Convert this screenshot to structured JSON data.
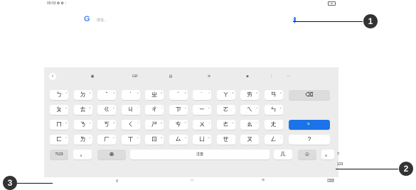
{
  "status": {
    "time": "09:03 ✿ ✿ ↑",
    "battery": "80"
  },
  "search": {
    "logo": "G",
    "placeholder": "搜尋..."
  },
  "toolbar": {
    "back": "‹",
    "items": [
      "▣",
      "GIF",
      "▤",
      "✲",
      "☻",
      "⋮",
      "⋯"
    ]
  },
  "rows": [
    [
      [
        "ㄅ",
        "1"
      ],
      [
        "ㄉ",
        "2"
      ],
      [
        "ˇ",
        "3"
      ],
      [
        "ˋ",
        "4"
      ],
      [
        "ㄓ",
        "5"
      ],
      [
        "ˊ",
        "6"
      ],
      [
        "˙",
        "7"
      ],
      [
        "ㄚ",
        "8"
      ],
      [
        "ㄞ",
        "9"
      ],
      [
        "ㄢ",
        "0"
      ]
    ],
    [
      [
        "ㄆ",
        "q"
      ],
      [
        "ㄊ",
        "w"
      ],
      [
        "ㄍ",
        "e"
      ],
      [
        "ㄐ",
        "r"
      ],
      [
        "ㄔ",
        "t"
      ],
      [
        "ㄗ",
        "y"
      ],
      [
        "ㄧ",
        "u"
      ],
      [
        "ㄛ",
        "i"
      ],
      [
        "ㄟ",
        "o"
      ],
      [
        "ㄣ",
        "p"
      ]
    ],
    [
      [
        "ㄇ",
        "a"
      ],
      [
        "ㄋ",
        "s"
      ],
      [
        "ㄎ",
        "d"
      ],
      [
        "ㄑ",
        "f"
      ],
      [
        "ㄕ",
        "g"
      ],
      [
        "ㄘ",
        "h"
      ],
      [
        "ㄨ",
        "j"
      ],
      [
        "ㄜ",
        "k"
      ],
      [
        "ㄠ",
        "l"
      ],
      [
        "ㄤ",
        ";"
      ]
    ],
    [
      [
        "ㄈ",
        "z"
      ],
      [
        "ㄌ",
        "x"
      ],
      [
        "ㄏ",
        "c"
      ],
      [
        "ㄒ",
        "v"
      ],
      [
        "ㄖ",
        "b"
      ],
      [
        "ㄙ",
        "n"
      ],
      [
        "ㄩ",
        "m"
      ],
      [
        "ㄝ",
        ","
      ],
      [
        "ㄡ",
        "."
      ],
      [
        "ㄥ",
        "/"
      ]
    ]
  ],
  "keys": {
    "delete": "⌫",
    "search": "🔍",
    "question": "?",
    "sym": "?123",
    "comma": "，",
    "globe": "⊕",
    "space": "注音",
    "er": "ㄦ",
    "emoji": "☺",
    "period": "。",
    "sym2": "?123"
  },
  "nav": {
    "back": "∨",
    "home": "○",
    "recents": "≡",
    "kbd": "⌨"
  },
  "callouts": {
    "c1": "1",
    "c2": "2",
    "c3": "3"
  }
}
